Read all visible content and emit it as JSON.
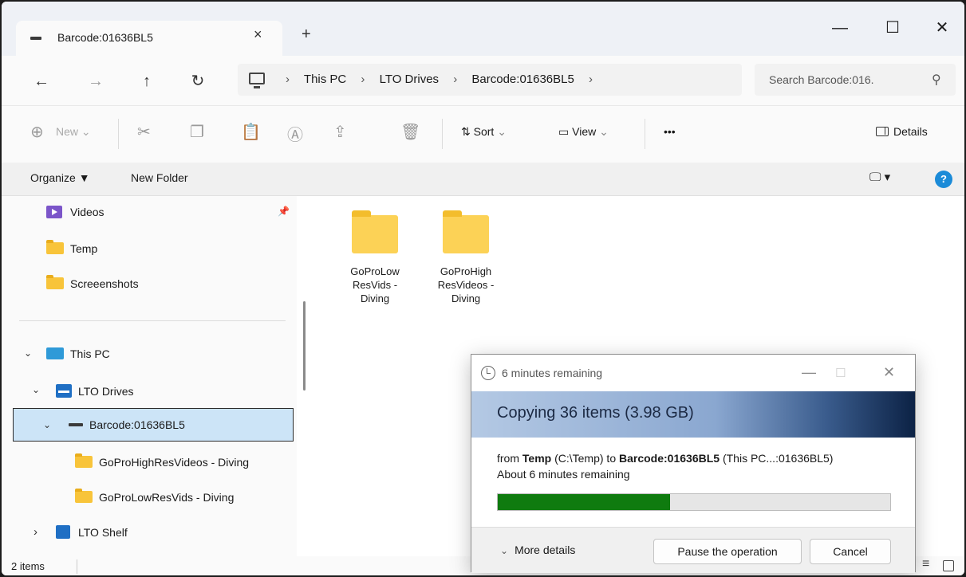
{
  "window": {
    "tab_title": "Barcode:01636BL5",
    "tab_close": "×",
    "new_tab": "+",
    "minimize": "—",
    "maximize": "☐",
    "close": "✕"
  },
  "nav_buttons": {
    "back": "←",
    "forward": "→",
    "up": "↑",
    "refresh": "↻"
  },
  "address": {
    "crumbs": [
      "This PC",
      "LTO Drives",
      "Barcode:01636BL5"
    ],
    "separator": "›",
    "search_placeholder": "Search Barcode:016.",
    "search_icon": "⚲"
  },
  "toolbar": {
    "new_label": "New",
    "new_icon": "⊕",
    "cut_icon": "✂",
    "copy_icon": "❐",
    "paste_icon": "📋",
    "rename_icon": "Ⓐ",
    "share_icon": "⇪",
    "delete_icon": "🗑",
    "sort_label": "Sort",
    "sort_icon": "⇅",
    "view_label": "View",
    "view_icon": "▭",
    "more_label": "•••",
    "details_label": "Details",
    "dropdown_caret": "⌄"
  },
  "org_bar": {
    "organize_label": "Organize ▼",
    "new_folder_label": "New Folder",
    "view_mode_label": "🖵 ▾",
    "help_label": "?"
  },
  "sidebar": {
    "quick": [
      {
        "label": "Videos",
        "icon": "videos-icon"
      },
      {
        "label": "Temp",
        "icon": "folder-icon"
      },
      {
        "label": "Screeenshots",
        "icon": "folder-icon"
      }
    ],
    "pin_icon": "📌",
    "tree": {
      "this_pc": "This PC",
      "lto_drives": "LTO Drives",
      "barcode": "Barcode:01636BL5",
      "child1": "GoProHighResVideos - Diving",
      "child2": "GoProLowResVids - Diving",
      "lto_shelf": "LTO Shelf"
    },
    "expanded_chevron": "⌄",
    "collapsed_chevron": "›"
  },
  "content": {
    "folders": [
      {
        "name": "GoProLow ResVids - Diving",
        "line1": "GoProLow",
        "line2": "ResVids -",
        "line3": "Diving"
      },
      {
        "name": "GoProHigh ResVideos - Diving",
        "line1": "GoProHigh",
        "line2": "ResVideos -",
        "line3": "Diving"
      }
    ]
  },
  "status": {
    "item_count": "2 items",
    "list_view_icon": "≡"
  },
  "copy_dialog": {
    "title": "6 minutes remaining",
    "minimize": "—",
    "maximize": "☐",
    "close": "✕",
    "headline": "Copying 36 items (3.98 GB)",
    "from_prefix": "from ",
    "from_name": "Temp",
    "from_path": " (C:\\Temp) to ",
    "to_name": "Barcode:01636BL5",
    "to_path": " (This PC...:01636BL5)",
    "remaining": "About 6 minutes remaining",
    "progress_percent": 44,
    "more_details": "More details",
    "more_details_chevron": "⌄",
    "pause_label": "Pause the operation",
    "cancel_label": "Cancel",
    "progress_color": "#0f7b0f"
  }
}
